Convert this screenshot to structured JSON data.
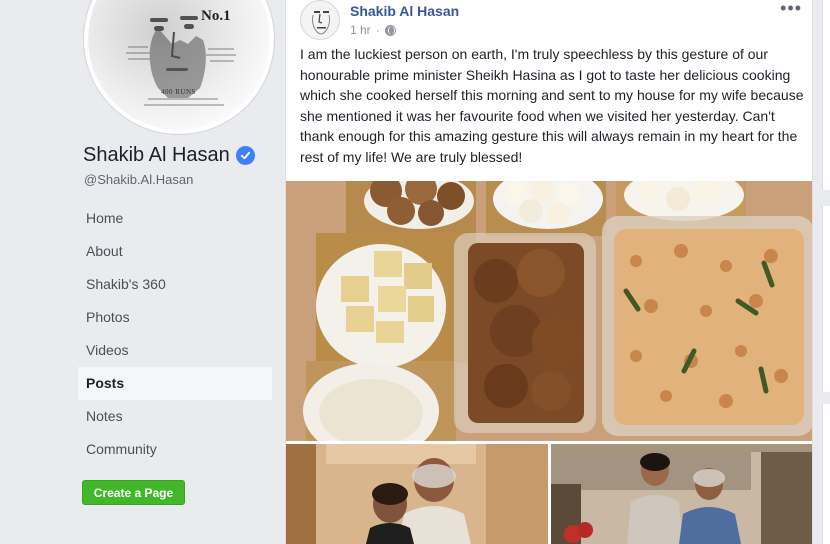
{
  "profile": {
    "name": "Shakib Al Hasan",
    "handle": "@Shakib.Al.Hasan",
    "avatar_badge": "No.1",
    "avatar_caption": "400 RUNS",
    "verified_icon": "verified-check-icon",
    "verified_color": "#4080ff"
  },
  "nav": {
    "items": [
      {
        "label": "Home",
        "active": false
      },
      {
        "label": "About",
        "active": false
      },
      {
        "label": "Shakib's 360",
        "active": false
      },
      {
        "label": "Photos",
        "active": false
      },
      {
        "label": "Videos",
        "active": false
      },
      {
        "label": "Posts",
        "active": true
      },
      {
        "label": "Notes",
        "active": false
      },
      {
        "label": "Community",
        "active": false
      }
    ],
    "create_page_label": "Create a Page",
    "create_page_color": "#42b72a"
  },
  "post": {
    "author": "Shakib Al Hasan",
    "time": "1 hr",
    "separator": "·",
    "privacy_icon": "globe-icon",
    "more_icon": "more-options-icon",
    "more_text": "•••",
    "text": "I am the luckiest person on earth, I'm truly speechless by this gesture of our honourable prime minister Sheikh Hasina as I got to taste her delicious cooking which she cooked herself this morning and sent to my house for my wife because she mentioned it was her favourite food when we visited her yesterday. Can't thank enough for this amazing gesture this will always remain in my heart for the rest of my life! We are truly blessed!",
    "author_color": "#365899"
  },
  "colors": {
    "page_bg": "#e9ebee",
    "card_bg": "#ffffff",
    "link": "#365899",
    "muted": "#90949c"
  }
}
